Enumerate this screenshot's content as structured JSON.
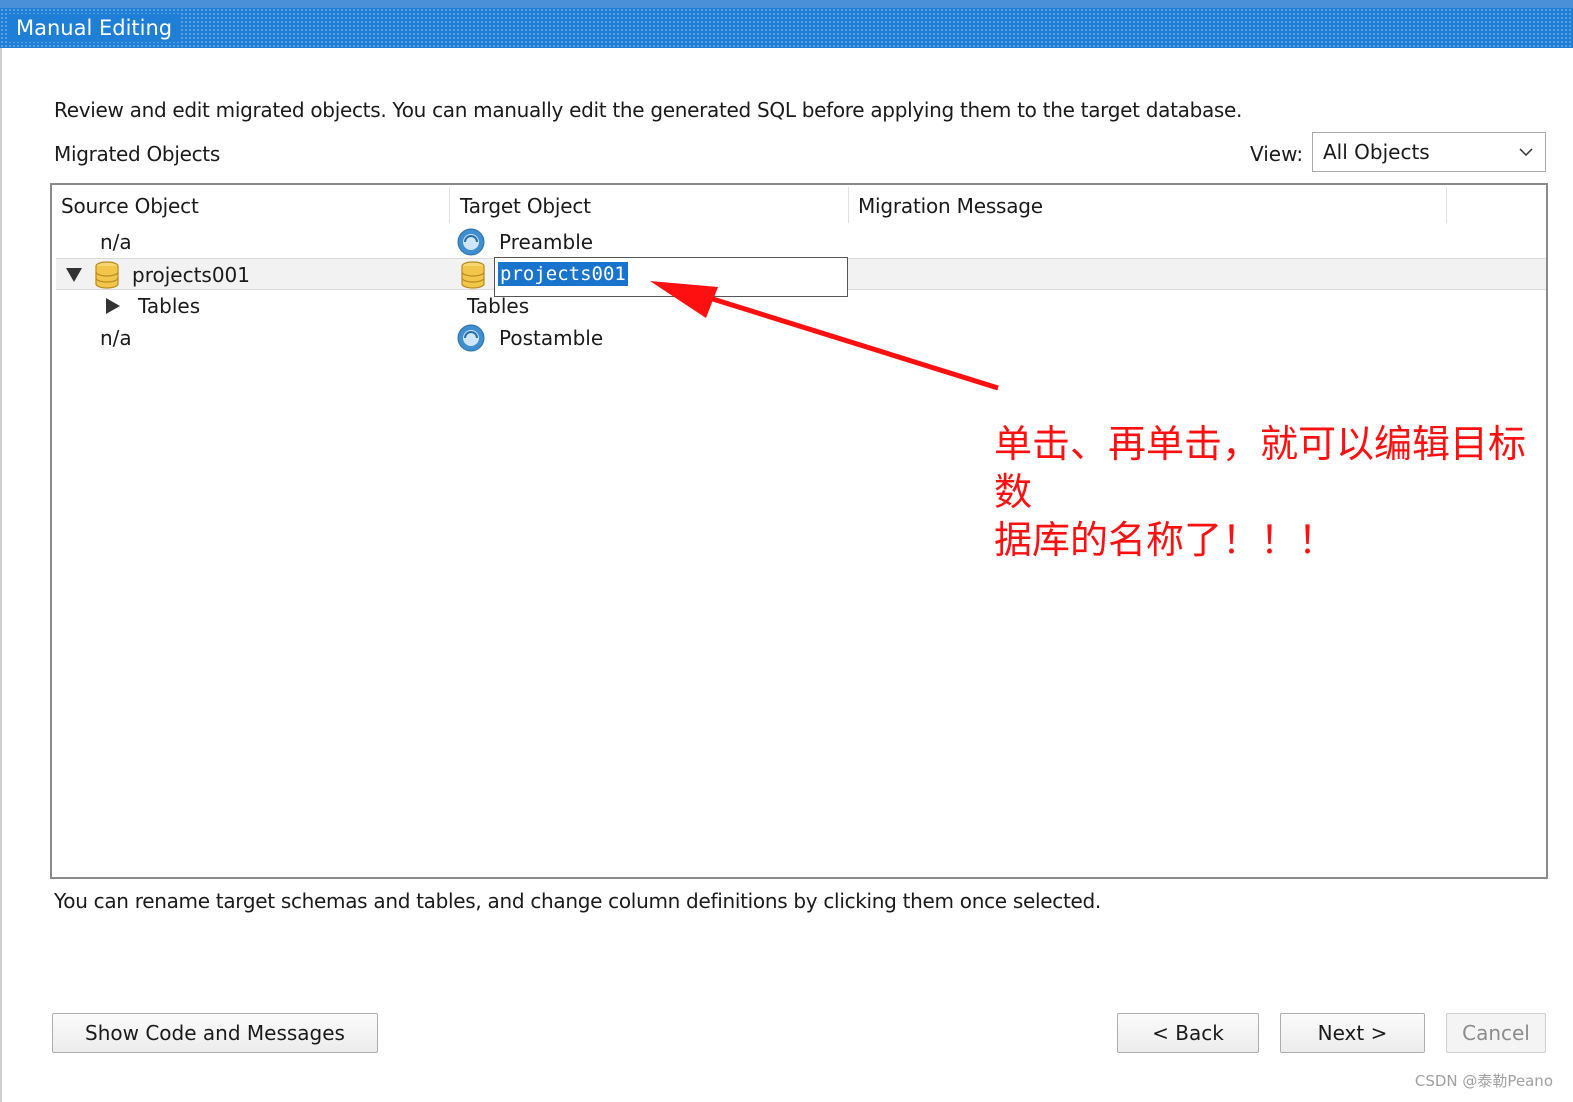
{
  "window": {
    "title": "Manual Editing"
  },
  "description": "Review and edit migrated objects. You can manually edit the generated SQL before applying them to the target database.",
  "section_label": "Migrated Objects",
  "view": {
    "label": "View:",
    "selected": "All Objects"
  },
  "tree": {
    "columns": [
      "Source Object",
      "Target Object",
      "Migration Message"
    ],
    "rows": [
      {
        "source": "n/a",
        "target": "Preamble",
        "message": ""
      },
      {
        "source": "projects001",
        "target": "projects001",
        "message": ""
      },
      {
        "source": "Tables",
        "target": "Tables",
        "message": ""
      },
      {
        "source": "n/a",
        "target": "Postamble",
        "message": ""
      }
    ]
  },
  "hint": "You can rename target schemas and tables, and change column definitions by clicking them once selected.",
  "buttons": {
    "show_code": "Show Code and Messages",
    "back": "< Back",
    "next": "Next >",
    "cancel": "Cancel"
  },
  "annotation": {
    "line1": "单击、再单击，就可以编辑目标数",
    "line2": "据库的名称了！！！",
    "color": "#ff1010"
  },
  "watermark": "CSDN @泰勒Peano",
  "colors": {
    "titlebar": "#1f7fd6",
    "selection": "#1874cd"
  }
}
